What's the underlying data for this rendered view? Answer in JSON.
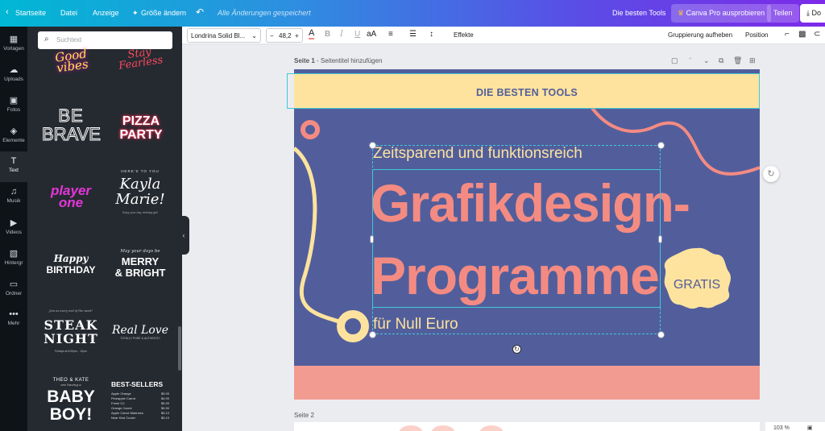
{
  "topbar": {
    "home": "Startseite",
    "file": "Datei",
    "view": "Anzeige",
    "resize": "Größe ändern",
    "undo_icon": "undo-icon",
    "saved_status": "Alle Änderungen gespeichert",
    "design_title": "Die besten Tools",
    "pro_button": "Canva Pro ausprobieren",
    "share_button": "Teilen",
    "download_button": "Do"
  },
  "rail": {
    "items": [
      {
        "label": "Vorlagen",
        "icon": "templates-icon"
      },
      {
        "label": "Uploads",
        "icon": "upload-icon"
      },
      {
        "label": "Fotos",
        "icon": "photos-icon"
      },
      {
        "label": "Elemente",
        "icon": "elements-icon"
      },
      {
        "label": "Text",
        "icon": "text-icon"
      },
      {
        "label": "Musik",
        "icon": "music-icon"
      },
      {
        "label": "Videos",
        "icon": "videos-icon"
      },
      {
        "label": "Hintergr",
        "icon": "background-icon"
      },
      {
        "label": "Ordner",
        "icon": "folder-icon"
      },
      {
        "label": "Mehr",
        "icon": "more-icon"
      }
    ]
  },
  "panel": {
    "search_placeholder": "Suchtext",
    "tiles": {
      "good_vibes": "Good vibes",
      "stay_fearless": "Stay Fearless",
      "be": "BE",
      "brave": "BRAVE",
      "pizza": "PIZZA",
      "party": "PARTY",
      "player": "player",
      "one": "one",
      "heres_to_you": "HERE'S TO YOU",
      "kayla": "Kayla",
      "marie": "Marie!",
      "enjoy": "Enjoy your day, birthday girl!",
      "happy": "Happy",
      "birthday": "BIRTHDAY",
      "may_your_days": "May your days be",
      "merry": "MERRY",
      "bright": "& BRIGHT",
      "join_us": "Join us every end of the week!",
      "steak": "STEAK",
      "night": "NIGHT",
      "fridays": "Fridays at 5:00pm - 10pm",
      "real_love": "Real Love",
      "real_love_sub": "TOTALLY PURE & AUTHENTIC",
      "theo_kate": "THEO & KATE",
      "are_having": "are having a",
      "baby": "BABY",
      "boy": "BOY!",
      "best_sellers": "BEST-SELLERS",
      "menu": [
        {
          "name": "Apple Orange",
          "price": "$5.99"
        },
        {
          "name": "Pineapple Carrot",
          "price": "$4.99"
        },
        {
          "name": "Fresh OJ",
          "price": "$5.99"
        },
        {
          "name": "Orange Carrot",
          "price": "$5.90"
        },
        {
          "name": "Apple Carrot Madness",
          "price": "$5.10"
        },
        {
          "name": "Near Kiwi Cooler",
          "price": "$5.10"
        }
      ]
    }
  },
  "toolbar": {
    "font": "Londrina Solid Bl...",
    "size_minus": "−",
    "size": "48,2",
    "size_plus": "+",
    "bold": "B",
    "italic": "I",
    "underline": "U",
    "case": "aA",
    "effects": "Effekte",
    "ungroup": "Gruppierung aufheben",
    "position": "Position"
  },
  "canvas": {
    "page1_prefix": "Seite 1",
    "page1_title_placeholder": " - Seitentitel hinzufügen",
    "page2_label": "Seite 2",
    "zoom": "103 %"
  },
  "design": {
    "band_title": "DIE BESTEN TOOLS",
    "subtitle": "Zeitsparend und funktionsreich",
    "headline_line1": "Grafikdesign-",
    "headline_line2": "Programme",
    "footline": "für Null Euro",
    "badge": "GRATIS",
    "colors": {
      "background": "#525e9c",
      "yellow": "#fde39d",
      "coral": "#f48b82",
      "pink_band": "#f29b91",
      "selection": "#3ec9d6"
    }
  }
}
